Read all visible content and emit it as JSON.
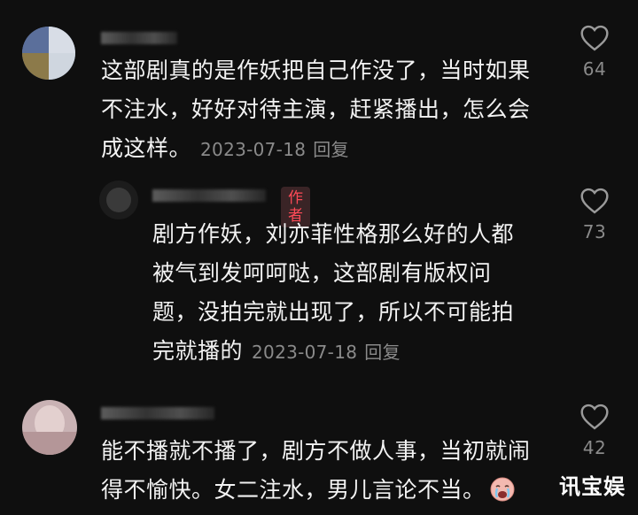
{
  "comments": [
    {
      "text": "这部剧真的是作妖把自己作没了，当时如果不注水，好好对待主演，赶紧播出，怎么会成这样。",
      "lines": [
        "这部剧真的是作妖把自己作没了，当时如果",
        "不注水，好好对待主演，赶紧播出，怎么会",
        "成这样。"
      ],
      "date": "2023-07-18",
      "reply_label": "回复",
      "likes": "64"
    },
    {
      "badge": "作者",
      "text": "剧方作妖，刘亦菲性格那么好的人都被气到发呵呵哒，这部剧有版权问题，没拍完就出现了，所以不可能拍完就播的",
      "lines": [
        "剧方作妖，刘亦菲性格那么好的人都",
        "被气到发呵呵哒，这部剧有版权问",
        "题，没拍完就出现了，所以不可能拍",
        "完就播的"
      ],
      "date": "2023-07-18",
      "reply_label": "回复",
      "likes": "73"
    },
    {
      "text": "能不播就不播了，剧方不做人事，当初就闹得不愉快。女二注水，男儿言论不当。",
      "lines": [
        "能不播就不播了，剧方不做人事，当初就闹",
        "得不愉快。女二注水，男儿言论不当。"
      ],
      "likes": "42",
      "emoji": "crying-face-emoji"
    }
  ],
  "watermark": "讯宝娱",
  "colors": {
    "background": "#0f0f0f",
    "text": "#f2f2f2",
    "meta": "#8a8a8a",
    "author_badge": "#fe4a57"
  }
}
